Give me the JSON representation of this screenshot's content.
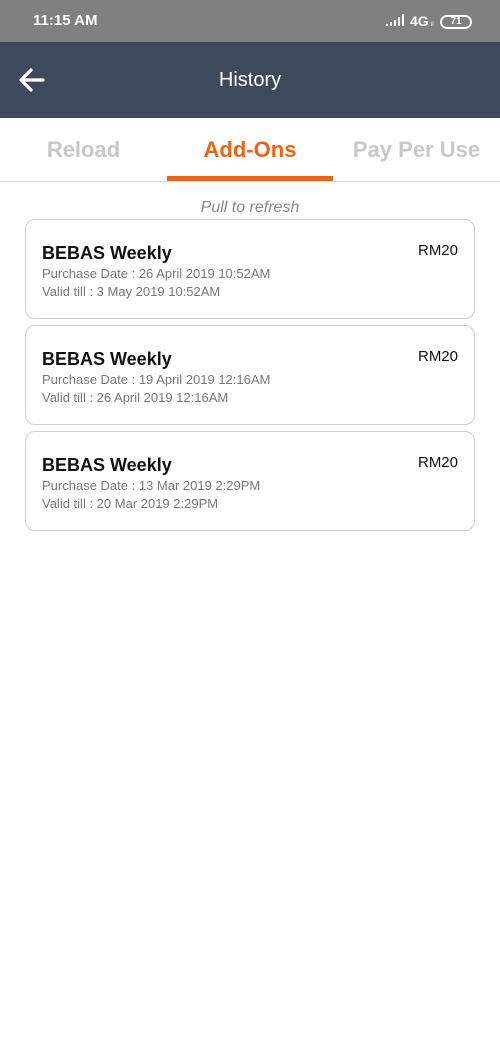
{
  "status_bar": {
    "time": "11:15 AM",
    "network": "4G",
    "network_sub": "ll",
    "battery": "71"
  },
  "app_bar": {
    "back_icon": "arrow-left-icon",
    "title": "History"
  },
  "tabs": [
    {
      "label": "Reload",
      "selected": false
    },
    {
      "label": "Add-Ons",
      "selected": true
    },
    {
      "label": "Pay Per Use",
      "selected": false
    }
  ],
  "colors": {
    "accent": "#f2630f",
    "app_bar": "#3d4a5c",
    "status_bar": "#808080"
  },
  "pull_hint": "Pull to refresh",
  "history": [
    {
      "name": "BEBAS Weekly",
      "price": "RM20",
      "purchase": "Purchase Date : 26 April 2019 10:52AM",
      "valid": "Valid till : 3 May 2019 10:52AM"
    },
    {
      "name": "BEBAS Weekly",
      "price": "RM20",
      "purchase": "Purchase Date : 19 April 2019 12:16AM",
      "valid": "Valid till : 26 April 2019 12:16AM"
    },
    {
      "name": "BEBAS Weekly",
      "price": "RM20",
      "purchase": "Purchase Date : 13 Mar 2019 2:29PM",
      "valid": "Valid till : 20 Mar 2019 2:29PM"
    }
  ]
}
